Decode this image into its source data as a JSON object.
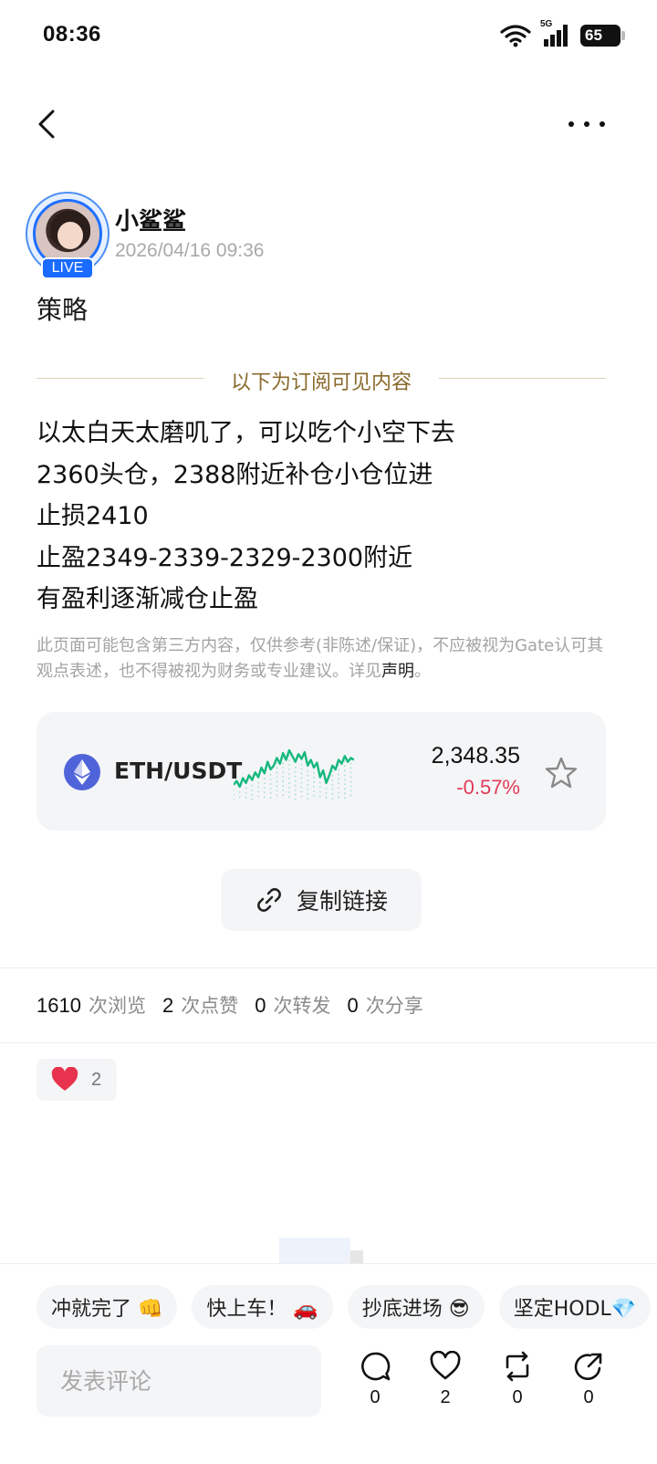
{
  "status_bar": {
    "time": "08:36",
    "network": "5G",
    "battery": "65"
  },
  "post": {
    "author": {
      "name": "小鲨鲨",
      "live_badge": "LIVE"
    },
    "timestamp": "2026/04/16 09:36",
    "title": "策略",
    "subscribe_divider": "以下为订阅可见内容",
    "body_lines": [
      "以太白天太磨叽了，可以吃个小空下去",
      "2360头仓，2388附近补仓小仓位进",
      "止损2410",
      "止盈2349-2339-2329-2300附近",
      "有盈利逐渐减仓止盈"
    ],
    "disclaimer": "此页面可能包含第三方内容，仅供参考(非陈述/保证)，不应被视为Gate认可其观点表述，也不得被视为财务或专业建议。详见",
    "disclaimer_link": "声明",
    "disclaimer_end": "。"
  },
  "ticker": {
    "pair": "ETH/USDT",
    "price": "2,348.35",
    "change": "-0.57%",
    "accent_color": "#14b87c",
    "down_color": "#e23a57",
    "sparkline": [
      40,
      44,
      38,
      47,
      42,
      50,
      45,
      53,
      48,
      58,
      52,
      64,
      56,
      60,
      68,
      62,
      73,
      66,
      76,
      70,
      64,
      72,
      67,
      74,
      60,
      66,
      58,
      63,
      48,
      55,
      42,
      50,
      60,
      56,
      66,
      62,
      70,
      64,
      68,
      66
    ]
  },
  "copy_link": {
    "label": "复制链接"
  },
  "stats": [
    {
      "value": "1610",
      "label": "次浏览"
    },
    {
      "value": "2",
      "label": "次点赞"
    },
    {
      "value": "0",
      "label": "次转发"
    },
    {
      "value": "0",
      "label": "次分享"
    }
  ],
  "reaction": {
    "emoji": "heart",
    "count": "2"
  },
  "quick_replies": [
    "冲就完了 👊",
    "快上车！ 🚗",
    "抄底进场 😎",
    "坚定HODL💎"
  ],
  "comment": {
    "placeholder": "发表评论"
  },
  "actions": [
    {
      "name": "comment",
      "count": "0"
    },
    {
      "name": "like",
      "count": "2"
    },
    {
      "name": "repost",
      "count": "0"
    },
    {
      "name": "share",
      "count": "0"
    }
  ]
}
